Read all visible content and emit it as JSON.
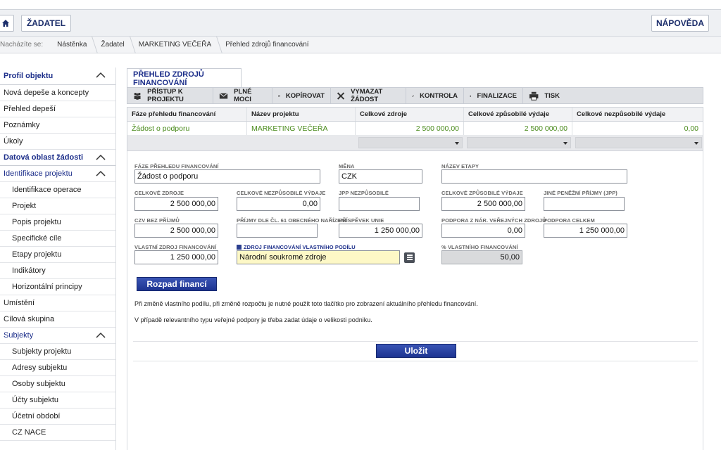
{
  "header": {
    "zadatel_label": "ŽADATEL",
    "napoveda_label": "NÁPOVĚDA"
  },
  "breadcrumb": {
    "prefix": "Nacházíte se:",
    "items": [
      "Nástěnka",
      "Žadatel",
      "MARKETING VEČEŘA",
      "Přehled zdrojů financování"
    ]
  },
  "sidebar": {
    "items": [
      {
        "label": "Profil objektu"
      },
      {
        "label": "Nová depeše a koncepty"
      },
      {
        "label": "Přehled depeší"
      },
      {
        "label": "Poznámky"
      },
      {
        "label": "Úkoly"
      },
      {
        "label": "Datová oblast žádosti"
      },
      {
        "label": "Identifikace projektu"
      },
      {
        "label": "Identifikace operace"
      },
      {
        "label": "Projekt"
      },
      {
        "label": "Popis projektu"
      },
      {
        "label": "Specifické cíle"
      },
      {
        "label": "Etapy projektu"
      },
      {
        "label": "Indikátory"
      },
      {
        "label": "Horizontální principy"
      },
      {
        "label": "Umístění"
      },
      {
        "label": "Cílová skupina"
      },
      {
        "label": "Subjekty"
      },
      {
        "label": "Subjekty projektu"
      },
      {
        "label": "Adresy subjektu"
      },
      {
        "label": "Osoby subjektu"
      },
      {
        "label": "Účty subjektu"
      },
      {
        "label": "Účetní období"
      },
      {
        "label": "CZ NACE"
      }
    ]
  },
  "page": {
    "tab_title": "PŘEHLED ZDROJŮ FINANCOVÁNÍ"
  },
  "toolbar": {
    "pristup": "PŘÍSTUP K PROJEKTU",
    "plne_moci": "PLNÉ MOCI",
    "kopirovat": "KOPÍROVAT",
    "vymazat": "VYMAZAT ŽÁDOST",
    "kontrola": "KONTROLA",
    "finalizace": "FINALIZACE",
    "tisk": "TISK"
  },
  "grid": {
    "headers": [
      "Fáze přehledu financování",
      "Název projektu",
      "Celkové zdroje",
      "Celkové způsobilé výdaje",
      "Celkové nezpůsobilé výdaje"
    ],
    "row": [
      "Žádost o podporu",
      "MARKETING VEČEŘA",
      "2 500 000,00",
      "2 500 000,00",
      "0,00"
    ]
  },
  "form": {
    "faze_label": "FÁZE PŘEHLEDU FINANCOVÁNÍ",
    "faze_value": "Žádost o podporu",
    "mena_label": "MĚNA",
    "mena_value": "CZK",
    "etapa_label": "NÁZEV ETAPY",
    "etapa_value": "",
    "celkove_zdroje_label": "CELKOVÉ ZDROJE",
    "celkove_zdroje_value": "2 500 000,00",
    "nezpusobile_label": "CELKOVÉ NEZPŮSOBILÉ VÝDAJE",
    "nezpusobile_value": "0,00",
    "jpp_label": "JPP NEZPŮSOBILÉ",
    "jpp_value": "",
    "zpusobile_label": "CELKOVÉ ZPŮSOBILÉ VÝDAJE",
    "zpusobile_value": "2 500 000,00",
    "jine_label": "JINÉ PENĚŽNÍ PŘÍJMY (JPP)",
    "jine_value": "",
    "czv_label": "CZV BEZ PŘÍJMŮ",
    "czv_value": "2 500 000,00",
    "prijmy_label": "PŘÍJMY DLE ČL. 61 OBECNÉHO NAŘÍZENÍ",
    "prijmy_value": "",
    "prispevek_label": "PŘÍSPĚVEK UNIE",
    "prispevek_value": "1 250 000,00",
    "podpora_nar_label": "PODPORA Z NÁR. VEŘEJNÝCH ZDROJŮ",
    "podpora_nar_value": "0,00",
    "podpora_celkem_label": "PODPORA CELKEM",
    "podpora_celkem_value": "1 250 000,00",
    "vlastni_label": "VLASTNÍ ZDROJ FINANCOVÁNÍ",
    "vlastni_value": "1 250 000,00",
    "zdroj_label": "ZDROJ FINANCOVÁNÍ VLASTNÍHO PODÍLU",
    "zdroj_value": "Národní soukromé zdroje",
    "procento_label": "% VLASTNÍHO FINANCOVÁNÍ",
    "procento_value": "50,00"
  },
  "buttons": {
    "rozpad": "Rozpad financí",
    "ulozit": "Uložit"
  },
  "notes": {
    "note1": "Při změně vlastního podílu, při změně rozpočtu je nutné použít toto tlačítko pro zobrazení aktuálního přehledu financování.",
    "note2": "V případě relevantního typu veřejné podpory je třeba zadat údaje o velikosti podniku."
  },
  "colors": {
    "brand_blue": "#1c2e8a",
    "green_value": "#4a8b1c",
    "field_yellow": "#fdf8c6"
  }
}
